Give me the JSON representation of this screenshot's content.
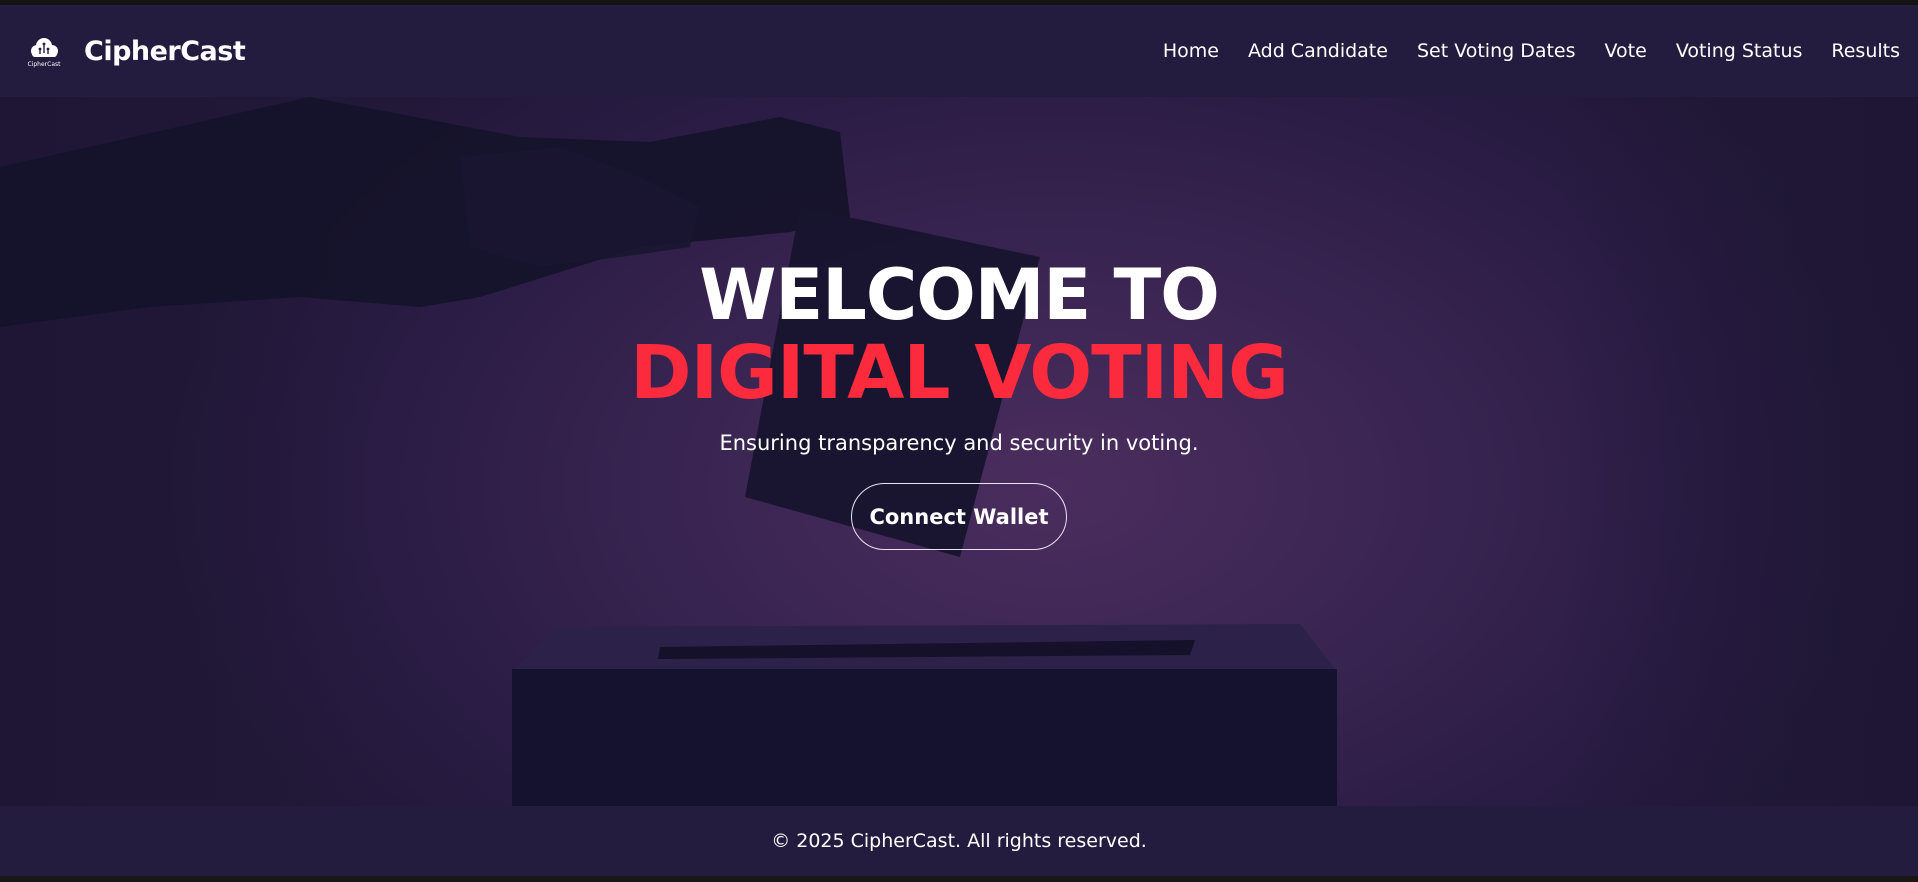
{
  "colors": {
    "navbar_bg": "#241c3e",
    "hero_bg": "#3a2552",
    "accent_red": "#fb2a3c",
    "text": "#ffffff"
  },
  "brand": {
    "logo_icon": "cloud-logo-icon",
    "logo_text": "CipherCast",
    "name": "CipherCast"
  },
  "nav": {
    "items": [
      {
        "label": "Home"
      },
      {
        "label": "Add Candidate"
      },
      {
        "label": "Set Voting Dates"
      },
      {
        "label": "Vote"
      },
      {
        "label": "Voting Status"
      },
      {
        "label": "Results"
      }
    ]
  },
  "hero": {
    "title_line1": "WELCOME TO",
    "title_line2": "DIGITAL VOTING",
    "subtitle": "Ensuring transparency and security in voting.",
    "cta_label": "Connect Wallet"
  },
  "footer": {
    "text": "© 2025 CipherCast. All rights reserved."
  }
}
